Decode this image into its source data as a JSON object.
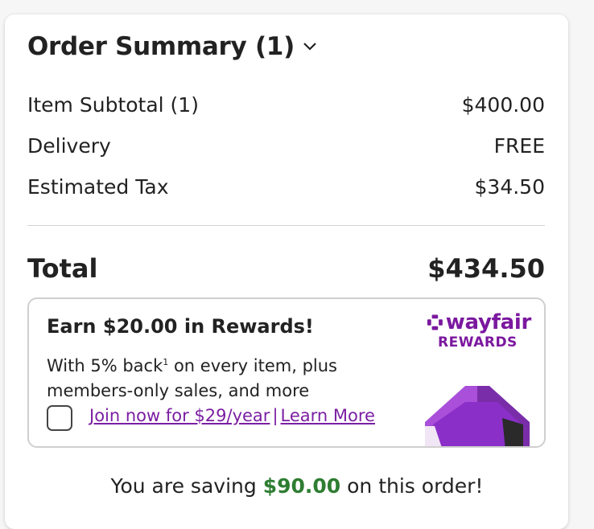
{
  "summary": {
    "title": "Order Summary (1)",
    "lines": [
      {
        "label": "Item Subtotal (1)",
        "value": "$400.00"
      },
      {
        "label": "Delivery",
        "value": "FREE"
      },
      {
        "label": "Estimated Tax",
        "value": "$34.50"
      }
    ],
    "total_label": "Total",
    "total_value": "$434.50"
  },
  "rewards": {
    "title": "Earn $20.00 in Rewards!",
    "desc_part1": "With 5% back",
    "desc_sup": "1",
    "desc_part2": " on every item, plus members-only sales, and more",
    "join_link": "Join now for $29/year",
    "separator": "|",
    "learn_link": "Learn More",
    "logo_word": "wayfair",
    "logo_sub": "REWARDS",
    "brand_color": "#7b189f"
  },
  "saving": {
    "prefix": "You are saving ",
    "amount": "$90.00",
    "suffix": " on this order!",
    "amount_color": "#2e7d32"
  },
  "icons": [
    "chevron-down-icon",
    "wayfair-logo-icon",
    "rewards-gem-icon"
  ]
}
